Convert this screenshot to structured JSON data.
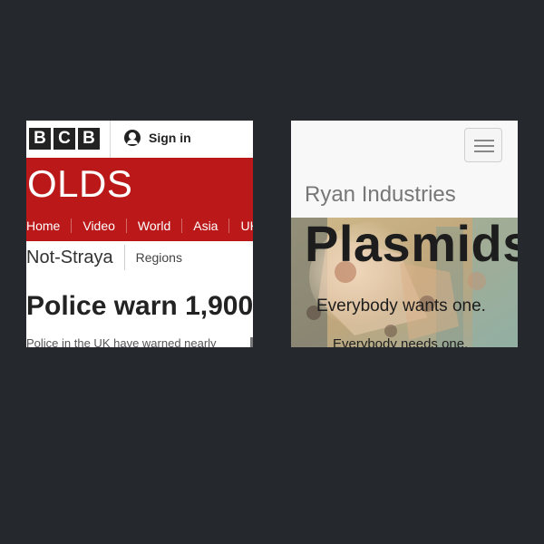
{
  "left_site": {
    "logo_letters": [
      "B",
      "C",
      "B"
    ],
    "signin_label": "Sign in",
    "brand_title": "OLDS",
    "nav_items": [
      "Home",
      "Video",
      "World",
      "Asia",
      "UK"
    ],
    "section_title": "Not-Straya",
    "regions_label": "Regions",
    "headline": "Police warn 1,900",
    "summary": "Police in the UK have warned nearly",
    "colors": {
      "brand_red": "#bb1919",
      "text_dark": "#222222"
    }
  },
  "right_site": {
    "brand": "Ryan Industries",
    "menu_icon": "hamburger-menu-icon",
    "hero": {
      "title": "Plasmids",
      "subtitle": "Everybody wants one.",
      "subtitle2": "Everybody needs one."
    }
  },
  "page": {
    "background_color": "#25282c"
  }
}
